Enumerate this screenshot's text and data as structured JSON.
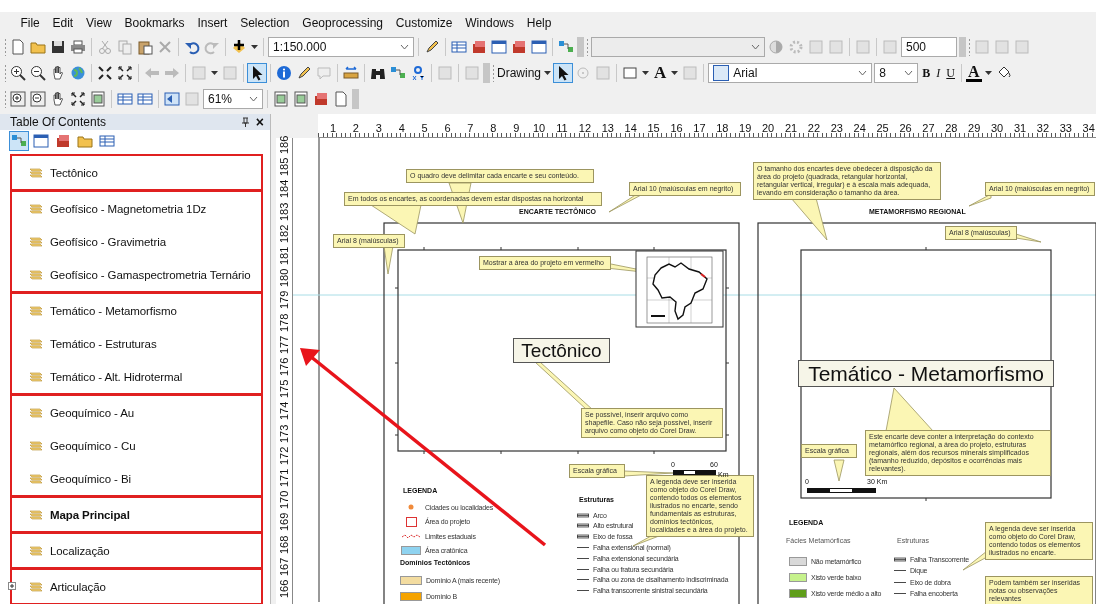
{
  "menu": [
    "File",
    "Edit",
    "View",
    "Bookmarks",
    "Insert",
    "Selection",
    "Geoprocessing",
    "Customize",
    "Windows",
    "Help"
  ],
  "toolbar": {
    "scale": "1:150.000",
    "count": "500",
    "drawing": "Drawing",
    "text_tool": "A",
    "font": "Arial",
    "font_size": "8",
    "bold": "B",
    "italic": "I",
    "underline": "U",
    "font_color": "A",
    "zoom": "61%",
    "tools": {
      "select": {
        "selected": true
      },
      "drawing_select": {
        "selected": true
      }
    }
  },
  "toc": {
    "title": "Table Of Contents",
    "close": "×",
    "tabs": [
      {
        "selected": true
      },
      {
        "selected": false
      },
      {
        "selected": false
      },
      {
        "selected": false
      },
      {
        "selected": false
      }
    ],
    "groups": [
      {
        "layers": [
          {
            "name": "Tectônico",
            "kind": "layer",
            "active": false
          }
        ]
      },
      {
        "layers": [
          {
            "name": "Geofísico - Magnetometria 1Dz",
            "kind": "layer",
            "active": false
          },
          {
            "name": "Geofísico - Gravimetria",
            "kind": "layer",
            "active": false
          },
          {
            "name": "Geofísico - Gamaspectrometria Ternário",
            "kind": "layer",
            "active": false
          }
        ]
      },
      {
        "layers": [
          {
            "name": "Temático - Metamorfismo",
            "kind": "layer",
            "active": false
          },
          {
            "name": "Temático - Estruturas",
            "kind": "layer",
            "active": false
          },
          {
            "name": "Temático - Alt. Hidrotermal",
            "kind": "layer",
            "active": false
          }
        ]
      },
      {
        "layers": [
          {
            "name": "Geoquímico - Au",
            "kind": "layer",
            "active": false
          },
          {
            "name": "Geoquímico - Cu",
            "kind": "layer",
            "active": false
          },
          {
            "name": "Geoquímico - Bi",
            "kind": "layer",
            "active": false
          }
        ]
      },
      {
        "layers": [
          {
            "name": "Mapa Principal",
            "kind": "layer",
            "active": true
          }
        ]
      },
      {
        "layers": [
          {
            "name": "Localização",
            "kind": "layer",
            "active": false
          }
        ]
      },
      {
        "layers": [
          {
            "name": "Articulação",
            "kind": "group",
            "active": false
          }
        ]
      }
    ]
  },
  "rulers": {
    "horizontal": [
      "1",
      "2",
      "3",
      "4",
      "5",
      "6",
      "7",
      "8",
      "9",
      "10",
      "11",
      "12",
      "13",
      "14",
      "15",
      "16",
      "17",
      "18",
      "19",
      "20",
      "21",
      "22",
      "23",
      "24",
      "25",
      "26",
      "27",
      "28",
      "29",
      "30",
      "31",
      "32",
      "33",
      "34"
    ],
    "vertical": [
      "186",
      "185",
      "184",
      "183",
      "182",
      "181",
      "180",
      "179",
      "178",
      "177",
      "176",
      "175",
      "174",
      "173",
      "172",
      "171",
      "170",
      "169",
      "168",
      "167",
      "166"
    ]
  },
  "layout": {
    "panels": [
      {
        "title": "ENCARTE TECTÔNICO",
        "map_label": "Tectônico",
        "callouts": [
          {
            "text": "O quadro deve delimitar cada encarte e seu conteúdo."
          },
          {
            "text": "Em todos os encartes, as coordenadas devem estar dispostas na horizontal"
          },
          {
            "text": "Arial 10 (maiúsculas em negrito)"
          },
          {
            "text": "Arial 8 (maiúsculas)"
          },
          {
            "text": "Mostrar a área do projeto em vermelho"
          },
          {
            "text": "Se possível, inserir arquivo como shapefile. Caso não seja possível, inserir arquivo como objeto do Corel Draw."
          },
          {
            "text": "Escala gráfica"
          },
          {
            "text": "A legenda deve ser inserida como objeto do Corel Draw, contendo todos os elementos ilustrados no encarte, sendo fundamentais as estruturas, domínios tectônicos, localidades e a área do projeto."
          }
        ],
        "scale_labels": [
          "0",
          "60",
          "Km"
        ],
        "legend": {
          "title": "LEGENDA",
          "groups": [
            {
              "items": [
                {
                  "label": "Cidades ou localidades",
                  "kind": "dot"
                },
                {
                  "label": "Área do projeto",
                  "kind": "outline"
                },
                {
                  "label": "Limites estaduais",
                  "kind": "dashed"
                },
                {
                  "label": "Área cratônica",
                  "kind": "fill",
                  "color": "#8fd3f0"
                }
              ]
            },
            {
              "heading": "Domínios Tectônicos",
              "items": [
                {
                  "label": "Domínio A (mais recente)",
                  "kind": "fill",
                  "color": "#f3dca0"
                },
                {
                  "label": "Domínio B",
                  "kind": "fill",
                  "color": "#f5a300"
                }
              ]
            },
            {
              "heading": "Estruturas",
              "items": [
                {
                  "label": "Arco",
                  "kind": "double"
                },
                {
                  "label": "Alto estrutural",
                  "kind": "double"
                },
                {
                  "label": "Eixo de fossa",
                  "kind": "double"
                },
                {
                  "label": "Falha extensional (normal)",
                  "kind": "line"
                },
                {
                  "label": "Falha extensional secundária",
                  "kind": "line"
                },
                {
                  "label": "Falha ou fratura secundária",
                  "kind": "line"
                },
                {
                  "label": "Falha ou zona de cisalhamento indiscriminada",
                  "kind": "line"
                },
                {
                  "label": "Falha transcorrente sinistral secundária",
                  "kind": "line"
                }
              ]
            }
          ]
        }
      },
      {
        "title": "METAMORFISMO REGIONAL",
        "map_label": "Temático - Metamorfismo",
        "callouts": [
          {
            "text": "O tamanho dos encartes deve obedecer à disposição da área do projeto (quadrada, retangular horizontal, retangular vertical, irregular) e à escala mais adequada, levando em consideração o tamanho da área."
          },
          {
            "text": "Arial 10 (maiúsculas em negrito)"
          },
          {
            "text": "Arial 8 (maiúsculas)"
          },
          {
            "text": "Escala gráfica"
          },
          {
            "text": "Este encarte deve conter a interpretação do contexto metamórfico regional, a área do projeto, estruturas regionais, além dos recursos minerais simplificados (tamanho reduzido, depósitos e ocorrências mais relevantes)."
          },
          {
            "text": "A legenda deve ser inserida como objeto do Corel Draw, contendo todos os elementos ilustrados no encarte."
          },
          {
            "text": "Podem também ser inseridas notas ou observações relevantes"
          }
        ],
        "scale_labels": [
          "0",
          "30 Km"
        ],
        "legend": {
          "title": "LEGENDA",
          "groups": [
            {
              "heading": "Fácies Metamórficas",
              "items": [
                {
                  "label": "Não metamórfico",
                  "kind": "fill",
                  "color": "#d9d9d9"
                },
                {
                  "label": "Xisto verde baixo",
                  "kind": "fill",
                  "color": "#c6f28c"
                },
                {
                  "label": "Xisto verde médio a alto",
                  "kind": "fill",
                  "color": "#5f9e1a"
                }
              ]
            },
            {
              "heading": "Estruturas",
              "items": [
                {
                  "label": "Falha Transcorrente",
                  "kind": "double"
                },
                {
                  "label": "Dique",
                  "kind": "line"
                },
                {
                  "label": "Eixo de dobra",
                  "kind": "line"
                },
                {
                  "label": "Falha encoberta",
                  "kind": "line"
                }
              ]
            }
          ]
        }
      }
    ]
  }
}
